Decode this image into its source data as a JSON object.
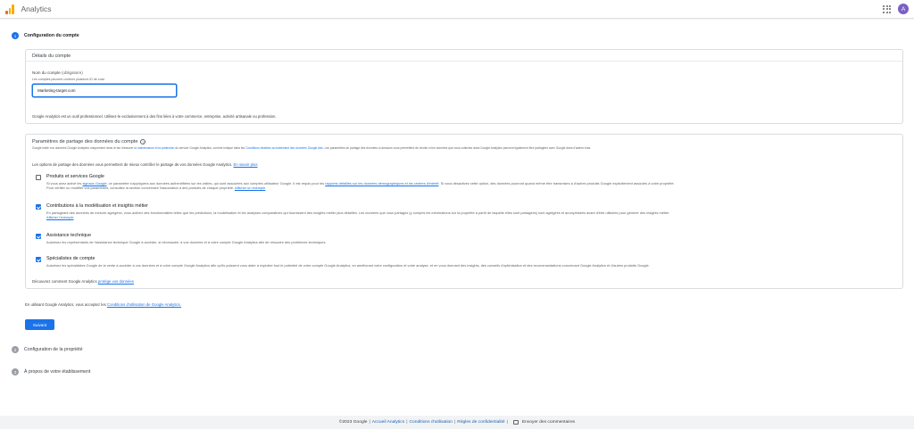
{
  "app": {
    "title": "Analytics",
    "avatar_letter": "A"
  },
  "steps": [
    {
      "number": "1",
      "label": "Configuration du compte"
    },
    {
      "number": "2",
      "label": "Configuration de la propriété"
    },
    {
      "number": "3",
      "label": "À propos de votre établissement"
    }
  ],
  "account_details": {
    "heading": "Détails du compte",
    "field_label": "Nom du compte",
    "field_required": "(obligatoire)",
    "field_hint": "Les comptes peuvent contenir plusieurs ID de suivi",
    "field_value": "Marketing-target.com",
    "note": "Google Analytics est un outil professionnel. Utilisez-le exclusivement à des fins liées à votre commerce, entreprise, activité artisanale ou profession."
  },
  "sharing": {
    "title": "Paramètres de partage des données du compte",
    "help_icon": "help-circle-icon",
    "desc_before": "Google traite vos données Google Analytics uniquement dans le but d'assurer",
    "desc_link1": "la maintenance et la protection",
    "desc_middle": "du service Google Analytics, comme indiqué dans les",
    "desc_link2": "Conditions relatives au traitement des données Google Ads",
    "desc_after": ". Les paramètres de partage des données ci-dessous vous permettent de choisir si les données que vous collectez dans Google Analytics peuvent également être partagées avec Google dans d'autres buts.",
    "intro_text": "Les options de partage des données vous permettent de mieux contrôler le partage de vos données Google Analytics.",
    "intro_link": "En savoir plus",
    "options": [
      {
        "title": "Produits et services Google",
        "checked": false,
        "line1_a": "Si vous avez activé les",
        "line1_link1": "signaux Google",
        "line1_b": ", ce paramètre s'appliquera aux données authentifiées sur les visites, qui sont associées aux comptes utilisateur Google. Il est requis pour les",
        "line1_link2": "rapports détaillés sur les données démographiques et les centres d'intérêt",
        "line1_c": ". Si vous désactivez cette option, des données pourront quand même être transmises à d'autres produits Google explicitement associés à votre propriété.",
        "line2": "Pour vérifier ou modifier vos paramètres, consultez la section concernant l'association à des produits de chaque propriété.",
        "line2_link": "Afficher un exemple"
      },
      {
        "title": "Contributions à la modélisation et insights métier",
        "checked": true,
        "line1": "En partageant des données de mesure agrégées, vous activez des fonctionnalités telles que les prédictions, la modélisation et les analyses comparatives qui fournissent des insights métier plus détaillés. Les données que vous partagez (y compris les informations sur la propriété à partir de laquelle elles sont partagées) sont agrégées et anonymisées avant d'être utilisées pour générer des insights métier.",
        "line2_link": "Afficher l'exemple"
      },
      {
        "title": "Assistance technique",
        "checked": true,
        "line1": "Autorisez les représentants de l'assistance technique Google à accéder, si nécessaire, à vos données et à votre compte Google Analytics afin de résoudre des problèmes techniques."
      },
      {
        "title": "Spécialistes de compte",
        "checked": true,
        "line1": "Autorisez les spécialistes Google de la vente à accéder à vos données et à votre compte Google Analytics afin qu'ils puissent vous aider à exploiter tout le potentiel de votre compte Google Analytics, en améliorant votre configuration et votre analyse, et en vous donnant des insights, des conseils d'optimisation et des recommandations concernant Google Analytics et d'autres produits Google."
      }
    ],
    "footer_text": "Découvrez comment Google Analytics",
    "footer_link": "protège vos données"
  },
  "terms": {
    "text": "En utilisant Google Analytics, vous acceptez les",
    "link": "Conditions d'utilisation de Google Analytics."
  },
  "next_button": "Suivant",
  "footer": {
    "copyright": "©2023 Google",
    "links": [
      "Accueil Analytics",
      "Conditions d'utilisation",
      "Règles de confidentialité"
    ],
    "feedback": "Envoyer des commentaires"
  },
  "colors": {
    "accent": "#1a73e8",
    "logo_orange": "#f9ab00",
    "avatar": "#7b5fc6"
  }
}
